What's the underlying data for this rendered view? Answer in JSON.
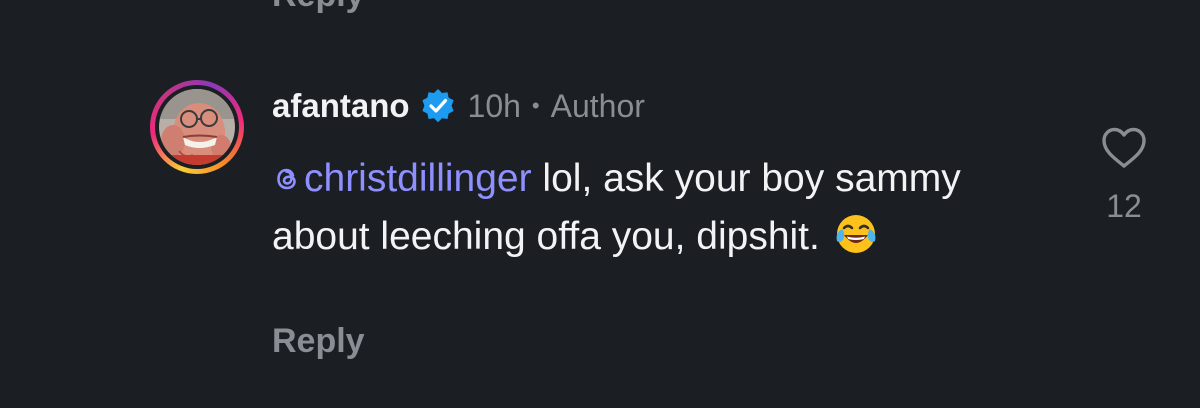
{
  "previous_comment": {
    "reply_label": "Reply"
  },
  "comment": {
    "username": "afantano",
    "verified": true,
    "time": "10h",
    "separator": "•",
    "role": "Author",
    "mention": "christdillinger",
    "text_after_mention": " lol, ask your boy sammy about leeching offa you, dipshit.",
    "emoji_icon": "face-with-tears-of-joy-icon",
    "reply_label": "Reply",
    "like_icon": "heart-outline-icon",
    "like_count": "12",
    "avatar_icon": "user-avatar",
    "colors": {
      "background": "#1b1e22",
      "primary_text": "#f2f3f5",
      "secondary_text": "#8a8d93",
      "mention": "#8f90ff",
      "verified_badge": "#1d9bf0"
    }
  }
}
